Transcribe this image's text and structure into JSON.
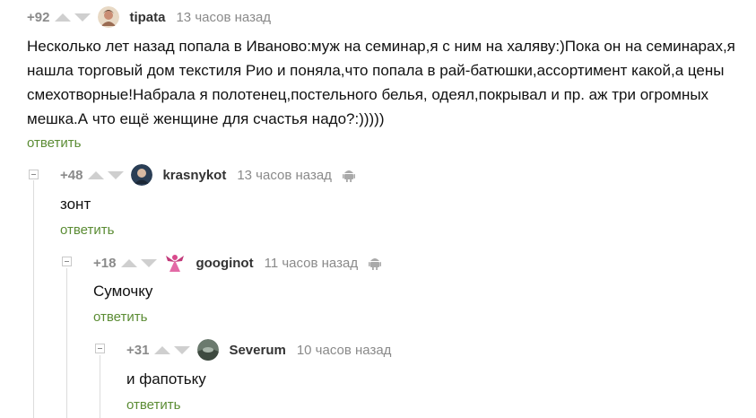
{
  "comments": [
    {
      "score": "+92",
      "nick": "tipata",
      "time": "13 часов назад",
      "text": "Несколько лет назад попала в Иваново:муж на семинар,я с ним на халяву:)Пока он на семинарах,я нашла торговый дом текстиля Рио и поняла,что попала в рай-батюшки,ассортимент какой,а цены смехотворные!Набрала я полотенец,постельного белья, одеял,покрывал и пр. аж три огромных мешка.А что ещё женщине для счастья надо?:)))))",
      "reply": "ответить",
      "android": false
    },
    {
      "score": "+48",
      "nick": "krasnykot",
      "time": "13 часов назад",
      "text": "зонт",
      "reply": "ответить",
      "android": true
    },
    {
      "score": "+18",
      "nick": "googinot",
      "time": "11 часов назад",
      "text": "Сумочку",
      "reply": "ответить",
      "android": true
    },
    {
      "score": "+31",
      "nick": "Severum",
      "time": "10 часов назад",
      "text": "и фапотьку",
      "reply": "ответить",
      "android": false
    }
  ],
  "icons": {
    "vote_up": "upvote-arrow-icon",
    "vote_down": "downvote-arrow-icon",
    "collapse": "collapse-minus-icon",
    "platform": "android-icon"
  },
  "colors": {
    "reply_link": "#5b8c34",
    "score": "#8a8a8a",
    "vote_arrow": "#cfcfcf"
  }
}
